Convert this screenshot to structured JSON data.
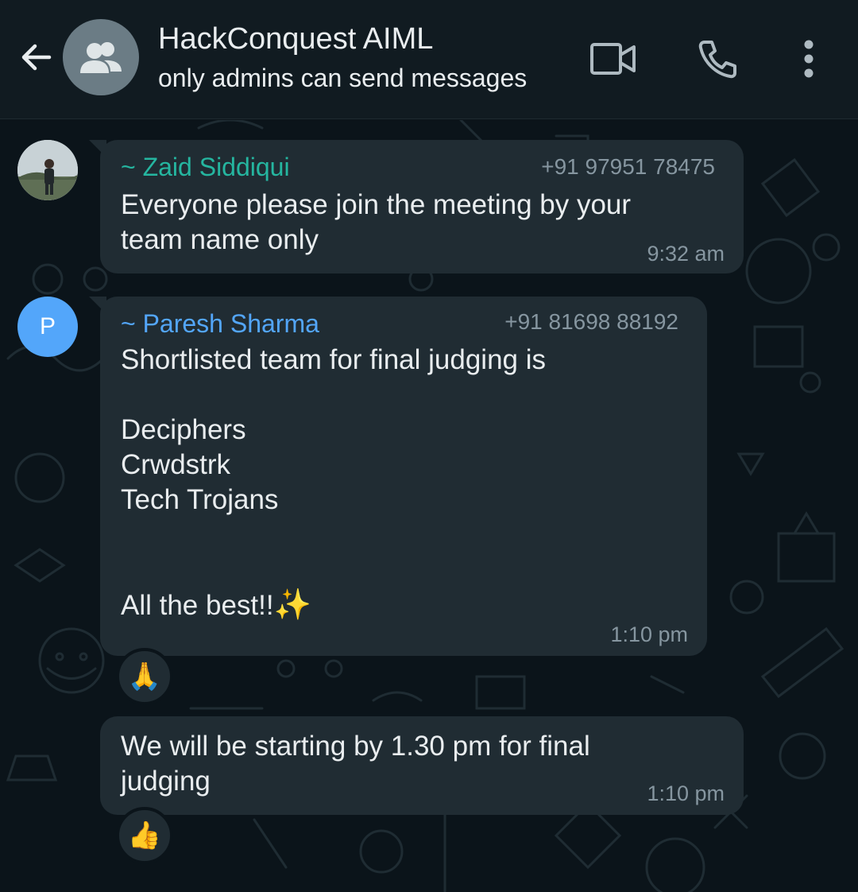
{
  "header": {
    "title": "HackConquest AIML",
    "subtitle": "only admins can send messages"
  },
  "messages": [
    {
      "sender": "~ Zaid Siddiqui",
      "sender_color": "#25b6a0",
      "phone": "+91 97951 78475",
      "text": "Everyone please join the meeting by your\nteam name only",
      "time": "9:32 am"
    },
    {
      "sender": "~ Paresh Sharma",
      "sender_color": "#53a6fa",
      "avatar_letter": "P",
      "phone": "+91 81698 88192",
      "text": "Shortlisted team for final judging is\n\nDeciphers\nCrwdstrk\nTech Trojans\n\n\nAll the best!!",
      "emoji": "✨",
      "time": "1:10 pm",
      "reaction": "🙏"
    },
    {
      "text": "We will be starting by 1.30 pm for final\njudging",
      "time": "1:10 pm",
      "reaction": "👍"
    }
  ],
  "icons": {
    "back": "arrow-left-icon",
    "group": "group-icon",
    "video": "video-camera-icon",
    "call": "phone-icon",
    "menu": "more-vertical-icon"
  },
  "colors": {
    "header_bg": "#111b21",
    "chat_bg": "#0b141a",
    "bubble_bg": "#202c33",
    "meta_text": "#8696a0"
  }
}
